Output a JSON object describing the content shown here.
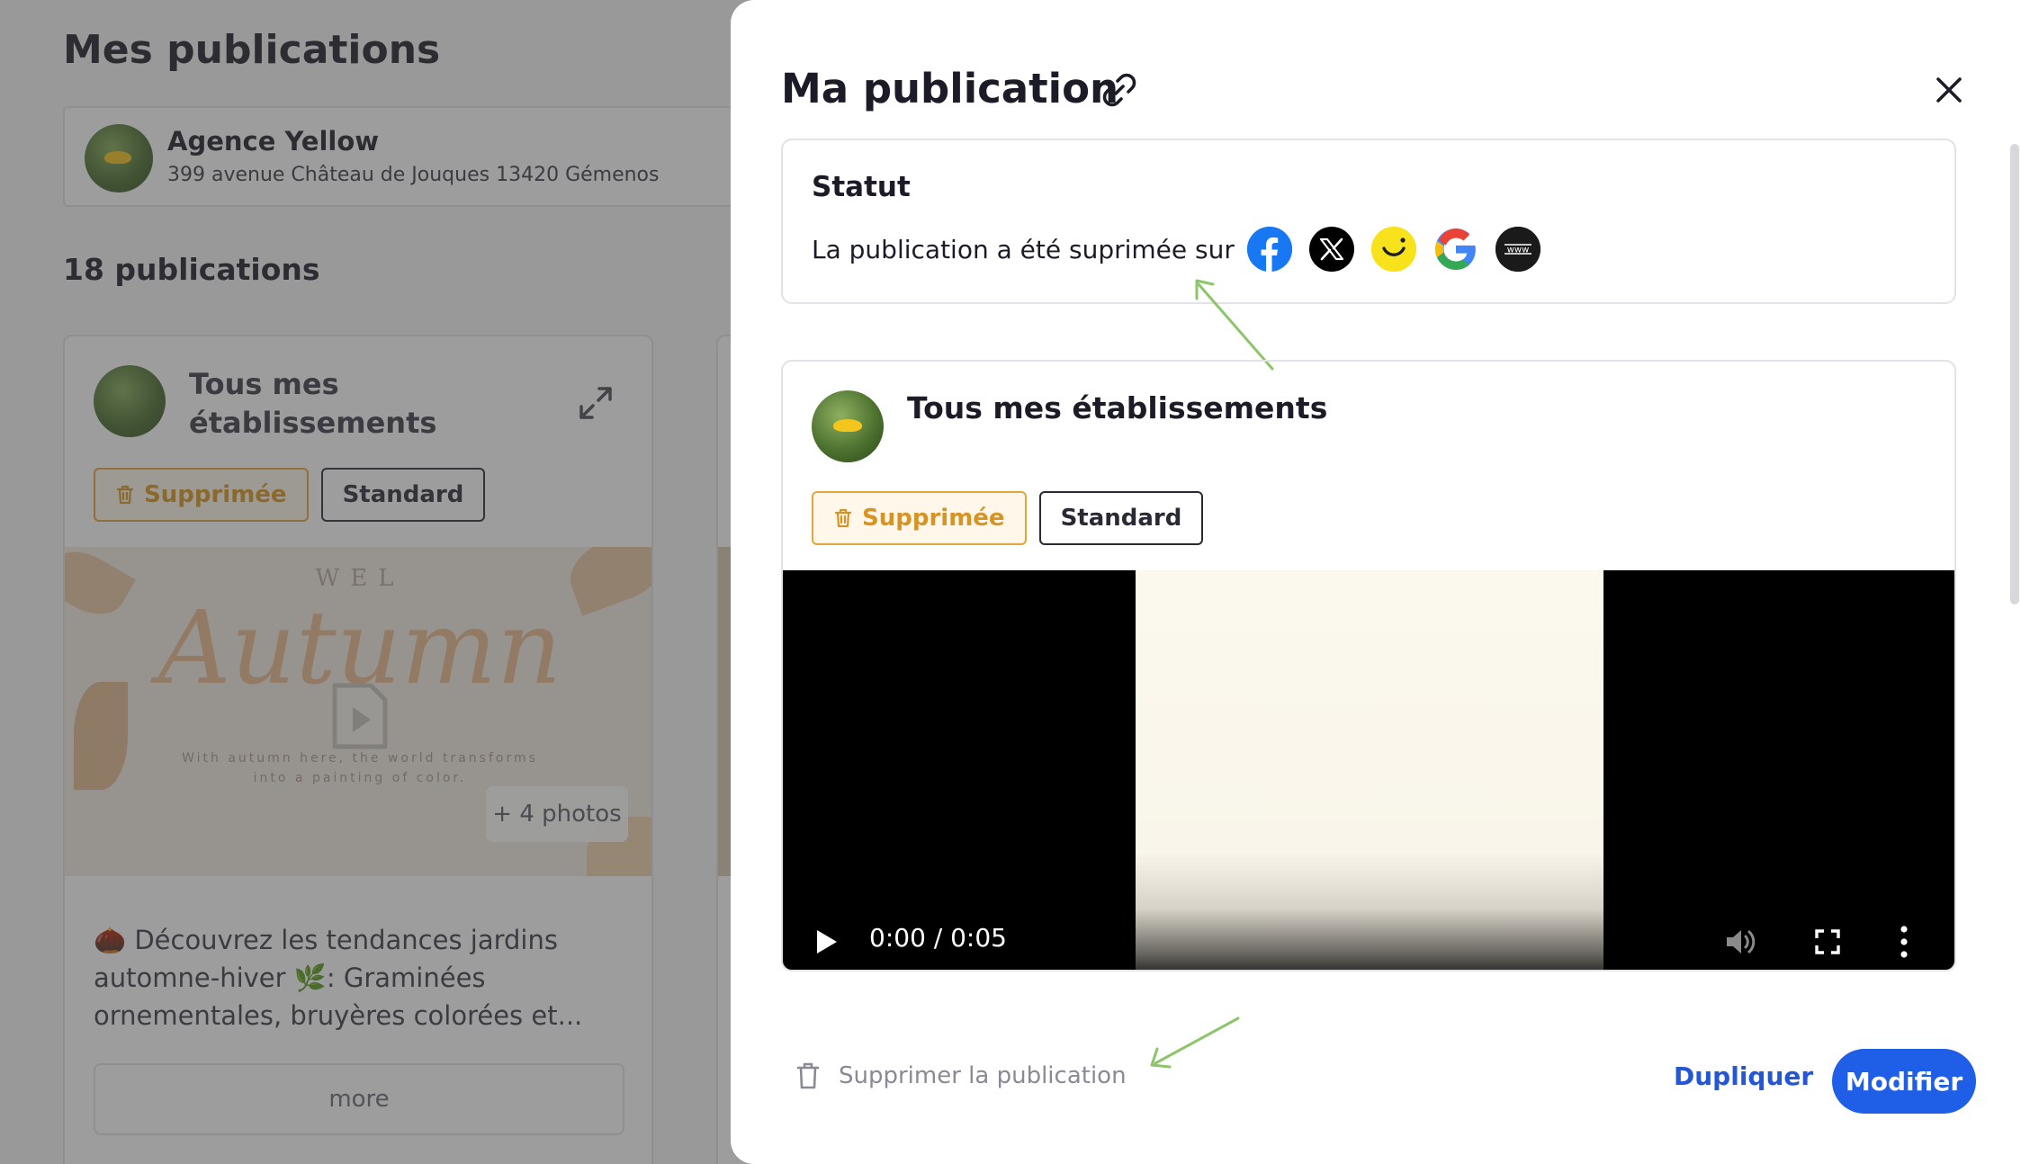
{
  "background": {
    "page_title": "Mes publications",
    "location": {
      "name": "Agence Yellow",
      "address": "399 avenue Château de Jouques 13420 Gémenos"
    },
    "count_label": "18 publications",
    "card": {
      "title": "Tous mes établissements",
      "tag_deleted": "Supprimée",
      "tag_standard": "Standard",
      "media_heading": "WEL",
      "media_word": "Autumn",
      "media_sub_line1": "With autumn here, the world transforms",
      "media_sub_line2": "into a painting of color.",
      "photos_badge": "+ 4 photos",
      "text": "🌰 Découvrez les tendances jardins automne-hiver 🌿: Graminées ornementales, bruyères colorées et...",
      "more_label": "more"
    }
  },
  "modal": {
    "title": "Ma publication",
    "status": {
      "title": "Statut",
      "text": "La publication a été suprimée sur",
      "networks": [
        "facebook-icon",
        "x-icon",
        "smiley-icon",
        "google-icon",
        "www-icon"
      ]
    },
    "publication": {
      "title": "Tous mes établissements",
      "tag_deleted": "Supprimée",
      "tag_standard": "Standard",
      "video": {
        "time": "0:00 / 0:05"
      }
    },
    "footer": {
      "delete_label": "Supprimer la publication",
      "duplicate_label": "Dupliquer",
      "edit_label": "Modifier"
    }
  },
  "colors": {
    "accent": "#1f5ee6",
    "link": "#2457d6",
    "deleted": "#d79424",
    "annotation_arrow": "#8cc56a"
  }
}
